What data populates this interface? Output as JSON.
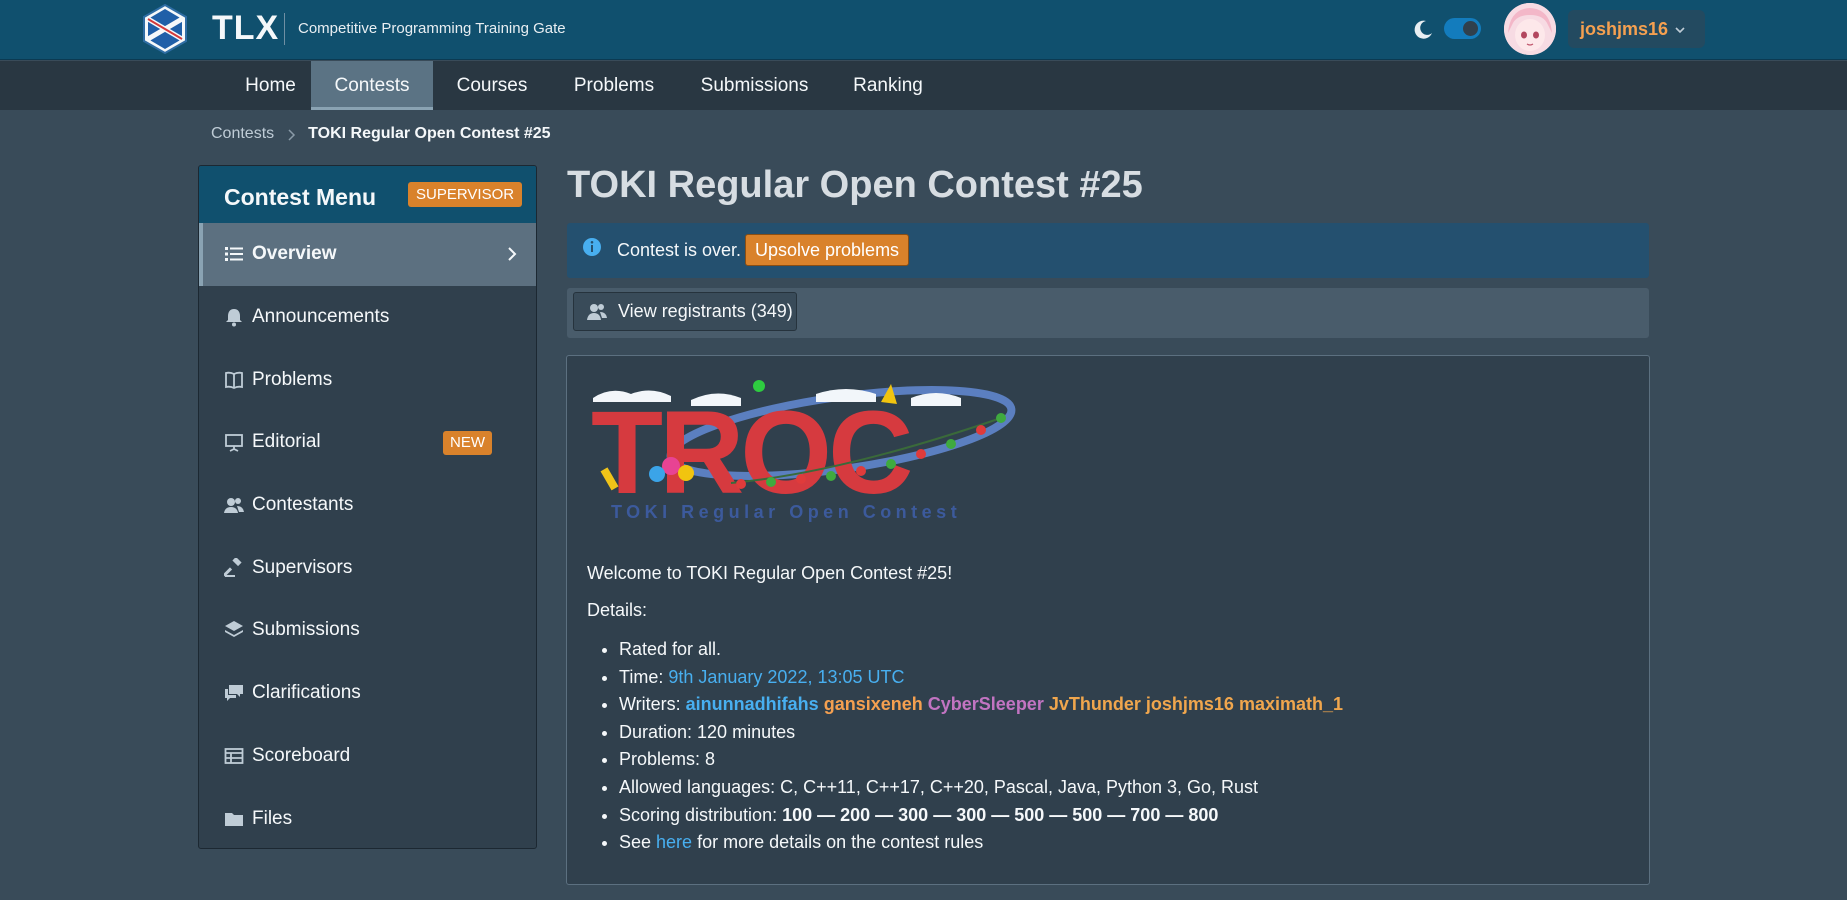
{
  "header": {
    "brand": "TLX",
    "tagline": "Competitive Programming Training Gate",
    "username": "joshjms16",
    "dark_mode_on": true
  },
  "nav": {
    "items": [
      {
        "label": "Home"
      },
      {
        "label": "Contests",
        "active": true
      },
      {
        "label": "Courses"
      },
      {
        "label": "Problems"
      },
      {
        "label": "Submissions"
      },
      {
        "label": "Ranking"
      }
    ]
  },
  "breadcrumb": {
    "parent": "Contests",
    "current": "TOKI Regular Open Contest #25"
  },
  "side_menu": {
    "title": "Contest Menu",
    "role_badge": "SUPERVISOR",
    "items": [
      {
        "label": "Overview",
        "icon": "list-icon",
        "active": true
      },
      {
        "label": "Announcements",
        "icon": "bell-icon"
      },
      {
        "label": "Problems",
        "icon": "book-icon"
      },
      {
        "label": "Editorial",
        "icon": "presentation-icon",
        "badge": "NEW"
      },
      {
        "label": "Contestants",
        "icon": "people-icon"
      },
      {
        "label": "Supervisors",
        "icon": "gavel-icon"
      },
      {
        "label": "Submissions",
        "icon": "layers-icon"
      },
      {
        "label": "Clarifications",
        "icon": "chat-icon"
      },
      {
        "label": "Scoreboard",
        "icon": "table-icon"
      },
      {
        "label": "Files",
        "icon": "folder-icon"
      }
    ]
  },
  "main": {
    "title": "TOKI Regular Open Contest #25",
    "callout": {
      "message": "Contest is over.",
      "button": "Upsolve problems"
    },
    "registrants_button": "View registrants (349)",
    "logo": {
      "word": "TROC",
      "subtitle": "TOKI Regular Open Contest"
    },
    "welcome": "Welcome to TOKI Regular Open Contest #25!",
    "details_label": "Details:",
    "details": {
      "rated": "Rated for all.",
      "time_label": "Time: ",
      "time_value": "9th January 2022, 13:05 UTC",
      "writers_label": "Writers: ",
      "writers": [
        "ainunnadhifahs",
        "gansixeneh",
        "CyberSleeper",
        "JvThunder",
        "joshjms16",
        "maximath_1"
      ],
      "duration": "Duration: 120 minutes",
      "problems": "Problems: 8",
      "languages": "Allowed languages: C, C++11, C++17, C++20, Pascal, Java, Python 3, Go, Rust",
      "scoring_label": "Scoring distribution: ",
      "scoring_value": "100 — 200 — 300 — 300 — 500 — 500 — 700 — 800",
      "see_prefix": "See ",
      "see_link": "here",
      "see_suffix": " for more details on the contest rules"
    }
  },
  "colors": {
    "header_bg": "#10506e",
    "accent_orange": "#d9822b",
    "link_blue": "#48aff0"
  }
}
